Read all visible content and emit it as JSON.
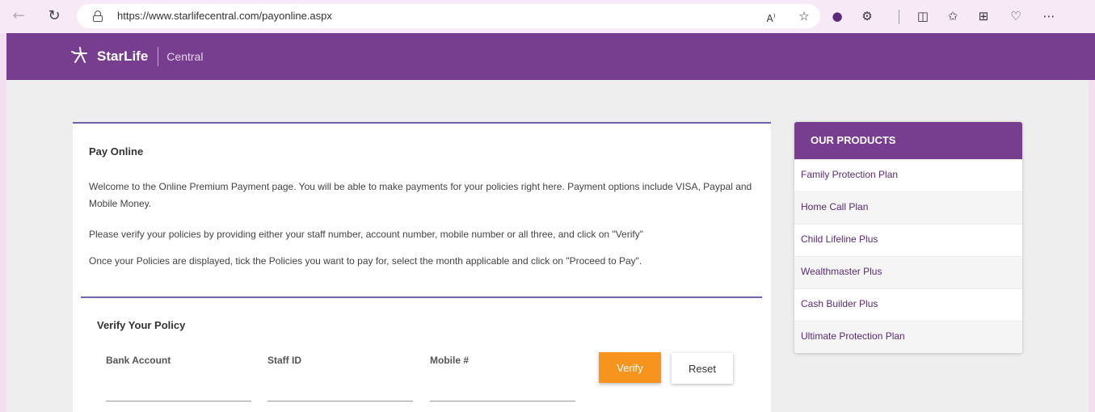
{
  "browser": {
    "url": "https://www.starlifecentral.com/payonline.aspx",
    "icons": [
      "back-icon",
      "refresh-icon",
      "lock-icon",
      "read-aloud-icon",
      "favorite-star-icon",
      "extension-icon",
      "puzzle-icon",
      "split-screen-icon",
      "favorites-icon",
      "collections-icon",
      "performance-icon",
      "more-icon"
    ]
  },
  "header": {
    "brand": "StarLife",
    "sub_brand": "Central",
    "color": "#773d8f"
  },
  "main": {
    "title": "Pay Online",
    "paragraph1": "Welcome to the Online Premium Payment page. You will be able to make payments for your policies right here. Payment options include VISA, Paypal and Mobile Money.",
    "paragraph2": "Please verify your policies by providing either your staff number, account number, mobile number or all three, and click on \"Verify\"",
    "paragraph3": "Once your Policies are displayed, tick the Policies you want to pay for, select the month applicable and click on \"Proceed to Pay\".",
    "verify": {
      "title": "Verify Your Policy",
      "bank_account_label": "Bank Account",
      "staff_id_label": "Staff ID",
      "mobile_label": "Mobile #",
      "bank_account_value": "",
      "staff_id_value": "",
      "mobile_value": "",
      "verify_button": "Verify",
      "reset_button": "Reset",
      "verify_color": "#f7941d"
    }
  },
  "products": {
    "title": "OUR PRODUCTS",
    "items": [
      "Family Protection Plan",
      "Home Call Plan",
      "Child Lifeline Plus",
      "Wealthmaster Plus",
      "Cash Builder Plus",
      "Ultimate Protection Plan"
    ]
  }
}
